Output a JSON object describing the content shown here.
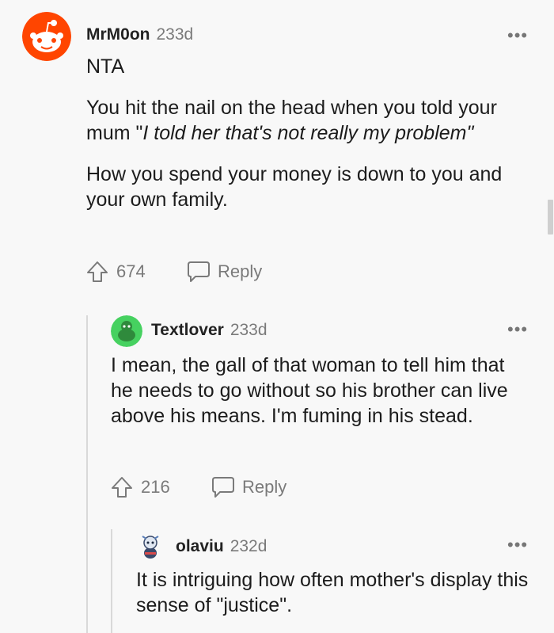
{
  "comments": [
    {
      "author": "MrM0on",
      "age": "233d",
      "body_line1": "NTA",
      "body_para2_plain": "You hit the nail on the head when you told your mum \"",
      "body_para2_italic": "I told her that's not really my problem\"",
      "body_para3": "How you spend your money is down to you and your own family.",
      "upvotes": "674",
      "reply_label": "Reply"
    },
    {
      "author": "Textlover",
      "age": "233d",
      "body": "I mean, the gall of that woman to tell him that he needs to go without so his brother can live above his means. I'm fuming in his stead.",
      "upvotes": "216",
      "reply_label": "Reply"
    },
    {
      "author": "olaviu",
      "age": "232d",
      "body": "It is intriguing how often mother's display this sense of \"justice\"."
    }
  ],
  "more_icon": "•••",
  "colors": {
    "avatar1": "#ff4500",
    "avatar2": "#46d160",
    "background": "#f8f8f8"
  }
}
